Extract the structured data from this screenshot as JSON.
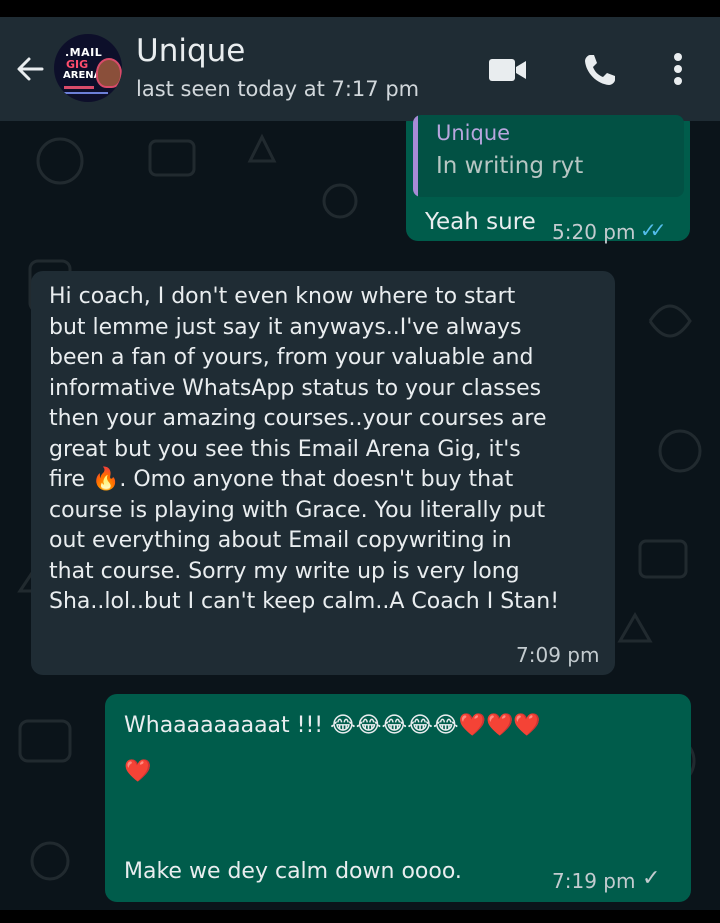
{
  "header": {
    "contact_name": "Unique",
    "last_seen": "last seen today at 7:17 pm",
    "avatar": {
      "line1": ".MAIL",
      "line2": "GIG",
      "line3": "ARENA"
    },
    "icons": [
      "back-arrow-icon",
      "video-call-icon",
      "voice-call-icon",
      "more-options-icon"
    ]
  },
  "messages": [
    {
      "direction": "outgoing",
      "quote": {
        "author": "Unique",
        "text": "In writing ryt"
      },
      "text": "Yeah sure",
      "time": "5:20 pm",
      "status": "read",
      "status_glyph": "✓✓"
    },
    {
      "direction": "incoming",
      "text": "Hi coach, I don't even know where to start\nbut lemme just say it anyways..I've always\nbeen a fan of yours, from your valuable and\ninformative WhatsApp status to your classes\nthen your amazing courses..your courses are\ngreat but you see this Email Arena Gig, it's\nfire 🔥. Omo anyone that doesn't buy that\ncourse is playing with Grace. You literally put\nout everything about Email copywriting in\nthat course. Sorry my write up is very long\nSha..lol..but I can't keep calm..A Coach I Stan!",
      "time": "7:09 pm"
    },
    {
      "direction": "outgoing",
      "text_line1": "Whaaaaaaaaat !!! 😂😂😂😂😂❤️❤️❤️",
      "text_line2": "❤️",
      "text_line3": "Make we dey calm down oooo.",
      "time": "7:19 pm",
      "status": "sent",
      "status_glyph": "✓"
    }
  ],
  "colors": {
    "header_bg": "#1f2c34",
    "chat_bg": "#0b141a",
    "outgoing_bubble": "#005c4b",
    "incoming_bubble": "#1f2c34",
    "read_ticks": "#53bdeb",
    "quote_accent": "#a78bd6"
  }
}
